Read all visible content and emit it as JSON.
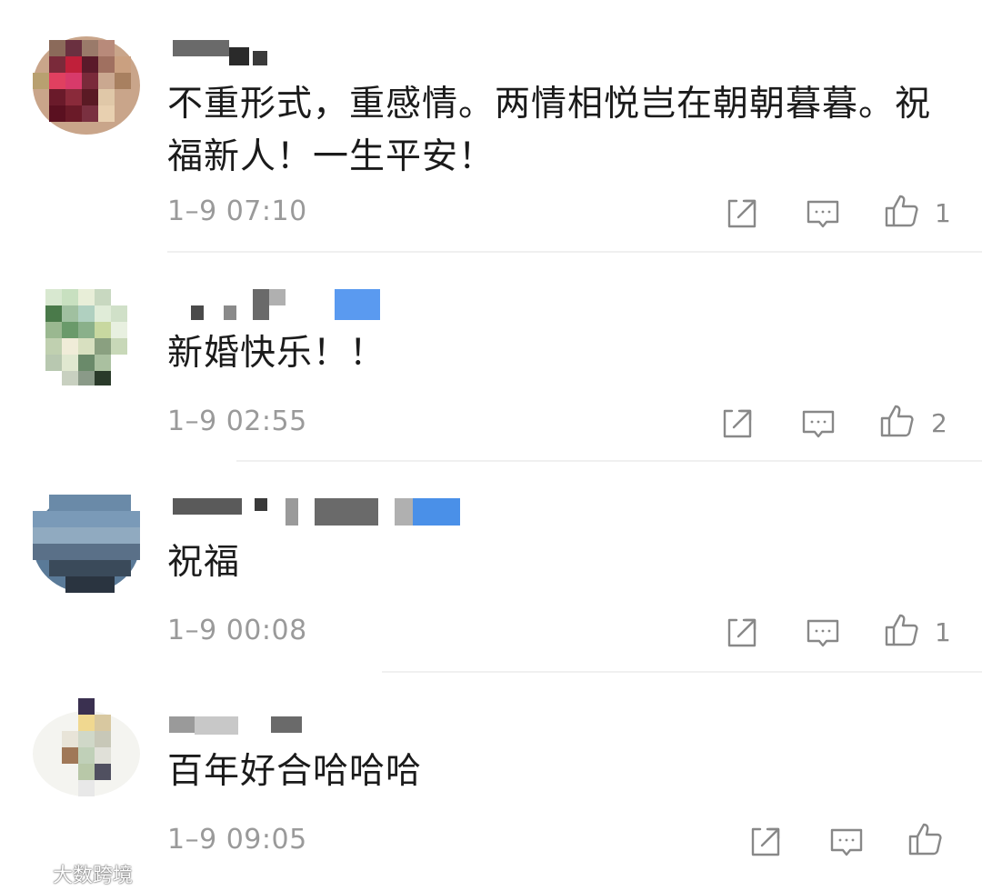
{
  "comments": [
    {
      "text": "不重形式，重感情。两情相悦岂在朝朝暮暮。祝\n福新人！一生平安！",
      "time": "1–9 07:10",
      "likes": "1"
    },
    {
      "text": "新婚快乐！！",
      "time": "1–9 02:55",
      "likes": "2"
    },
    {
      "text": "祝福",
      "time": "1–9 00:08",
      "likes": "1"
    },
    {
      "text": "百年好合哈哈哈",
      "time": "1–9 09:05",
      "likes": ""
    }
  ],
  "icons": {
    "share": "share-icon",
    "reply": "comment-icon",
    "like": "thumbs-up-icon"
  },
  "colors": {
    "text": "#1b1b1b",
    "meta": "#9a9a9a",
    "icon": "#888888",
    "divider": "#f0f0f0"
  },
  "watermark": {
    "text": "大数跨境"
  }
}
